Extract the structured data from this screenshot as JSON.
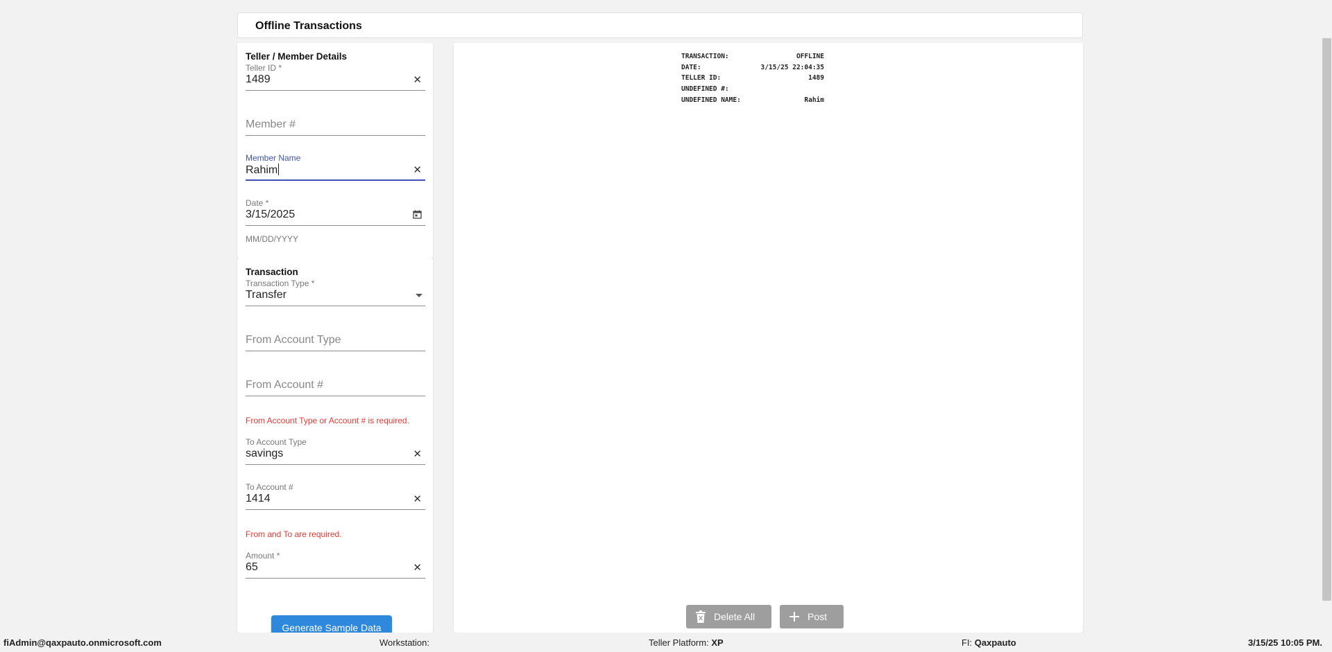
{
  "page": {
    "title": "Offline Transactions"
  },
  "teller_section": {
    "heading": "Teller / Member Details",
    "teller_id": {
      "label": "Teller ID *",
      "value": "1489"
    },
    "member_number": {
      "placeholder": "Member #"
    },
    "member_name": {
      "label": "Member Name",
      "value": "Rahim"
    },
    "date": {
      "label": "Date *",
      "value": "3/15/2025",
      "helper": "MM/DD/YYYY"
    }
  },
  "transaction_section": {
    "heading": "Transaction",
    "transaction_type": {
      "label": "Transaction Type *",
      "value": "Transfer"
    },
    "from_account_type": {
      "placeholder": "From Account Type"
    },
    "from_account_number": {
      "placeholder": "From Account #"
    },
    "from_error": "From Account Type or Account # is required.",
    "to_account_type": {
      "label": "To Account Type",
      "value": "savings"
    },
    "to_account_number": {
      "label": "To Account #",
      "value": "1414"
    },
    "to_error": "From and To are required.",
    "amount": {
      "label": "Amount *",
      "value": "65"
    },
    "generate_button": "Generate Sample Data"
  },
  "receipt": {
    "rows": [
      {
        "label": "TRANSACTION:",
        "value": "OFFLINE"
      },
      {
        "label": "DATE:",
        "value": "3/15/25 22:04:35"
      },
      {
        "label": "TELLER ID:",
        "value": "1489"
      },
      {
        "label": "UNDEFINED #:",
        "value": ""
      },
      {
        "label": "UNDEFINED NAME:",
        "value": "Rahim"
      }
    ]
  },
  "actions": {
    "delete_all": "Delete All",
    "post": "Post"
  },
  "status_bar": {
    "user": "fiAdmin@qaxpauto.onmicrosoft.com",
    "workstation_label": "Workstation:",
    "workstation_value": "",
    "platform_label": "Teller Platform:",
    "platform_value": "XP",
    "fi_label": "FI:",
    "fi_value": "Qaxpauto",
    "datetime": "3/15/25 10:05 PM."
  },
  "icons": {
    "clear": "close-icon",
    "calendar": "calendar-icon",
    "dropdown": "dropdown-arrow-icon",
    "delete": "trash-icon",
    "add": "plus-icon"
  },
  "colors": {
    "primary": "#2e88dc",
    "focus": "#3f51b5",
    "error": "#e53935",
    "disabled_button": "#9e9e9e"
  }
}
